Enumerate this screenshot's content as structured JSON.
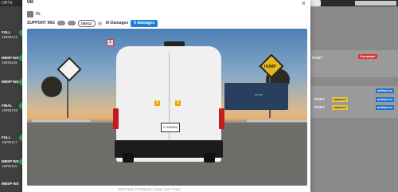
{
  "background_left": {
    "header_text": "ORTE",
    "rows": [
      {
        "line1": "FULL",
        "line2": "1MRB121"
      },
      {
        "line1": "MBSP  INS",
        "line2": "1MRB118"
      },
      {
        "line1": "MBSP  INS",
        "line2": ""
      },
      {
        "line1": "FINAL",
        "line2": "1MRB138"
      },
      {
        "line1": "FULL",
        "line2": "1MRB117"
      },
      {
        "line1": "MBSP  INS",
        "line2": "1MRB119"
      },
      {
        "line1": "MBSP  INS",
        "line2": ""
      }
    ]
  },
  "background_right": {
    "paint_label": "PAINT",
    "tag_red": "Yourpaper",
    "rows": [
      {
        "text": "- PAINT",
        "tag1": "repaired",
        "tag2": "artifact.co"
      },
      {
        "text": "- PAINT",
        "tag1": "repaired",
        "tag2": "artifact.co"
      }
    ],
    "tag_blue_1": "artifact.co"
  },
  "modal": {
    "title": "08",
    "close_symbol": "×",
    "chip_label": "PL",
    "support_label": "SUPPORT IMG",
    "support_oval": "DEIG2",
    "ai_damages_label": "AI Damages",
    "damages_button": "0 damages",
    "caption": "2022 Ram ProMaster Cargo Van • Rear"
  },
  "photo": {
    "plate_text": "C7G6M9Z",
    "sign_text": "HUMP",
    "truck_text": "prime",
    "markers": [
      "1",
      "2",
      "3"
    ]
  }
}
